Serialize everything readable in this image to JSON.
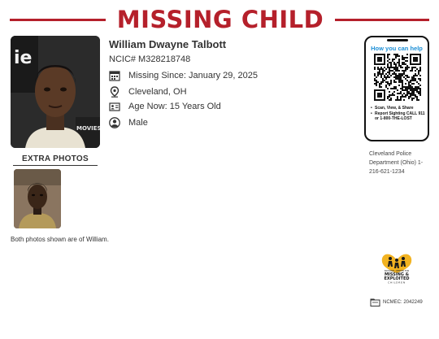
{
  "header": {
    "title": "MISSING CHILD"
  },
  "person": {
    "name": "William Dwayne Talbott",
    "ncic": "NCIC# M328218748",
    "missing_since": "Missing Since: January 29, 2025",
    "location": "Cleveland, OH",
    "age_now": "Age Now: 15 Years Old",
    "sex": "Male"
  },
  "photo_text": {
    "letters": "ie",
    "movies": "MOVIES"
  },
  "extra_photos": {
    "title": "EXTRA PHOTOS",
    "caption": "Both photos shown are of William."
  },
  "qr_card": {
    "title": "How you can help",
    "steps": [
      "Scan, View, & Share",
      "Report Sighting CALL 911 or 1-800-THE-LOST"
    ]
  },
  "contact": {
    "agency": "Cleveland Police Department (Ohio) 1-216-621-1234"
  },
  "ncmec": {
    "logo_lines": [
      "NATIONAL CENTER FOR",
      "MISSING &",
      "EXPLOITED",
      "CHILDREN"
    ],
    "case_number": "NCMEC: 2042249"
  },
  "icons": [
    "calendar-icon",
    "location-pin-icon",
    "id-card-icon",
    "person-icon",
    "qr-code-icon",
    "case-folder-icon"
  ],
  "colors": {
    "accent": "#b5202b",
    "help_blue": "#1d8fd6",
    "logo_gold": "#f2b322"
  }
}
